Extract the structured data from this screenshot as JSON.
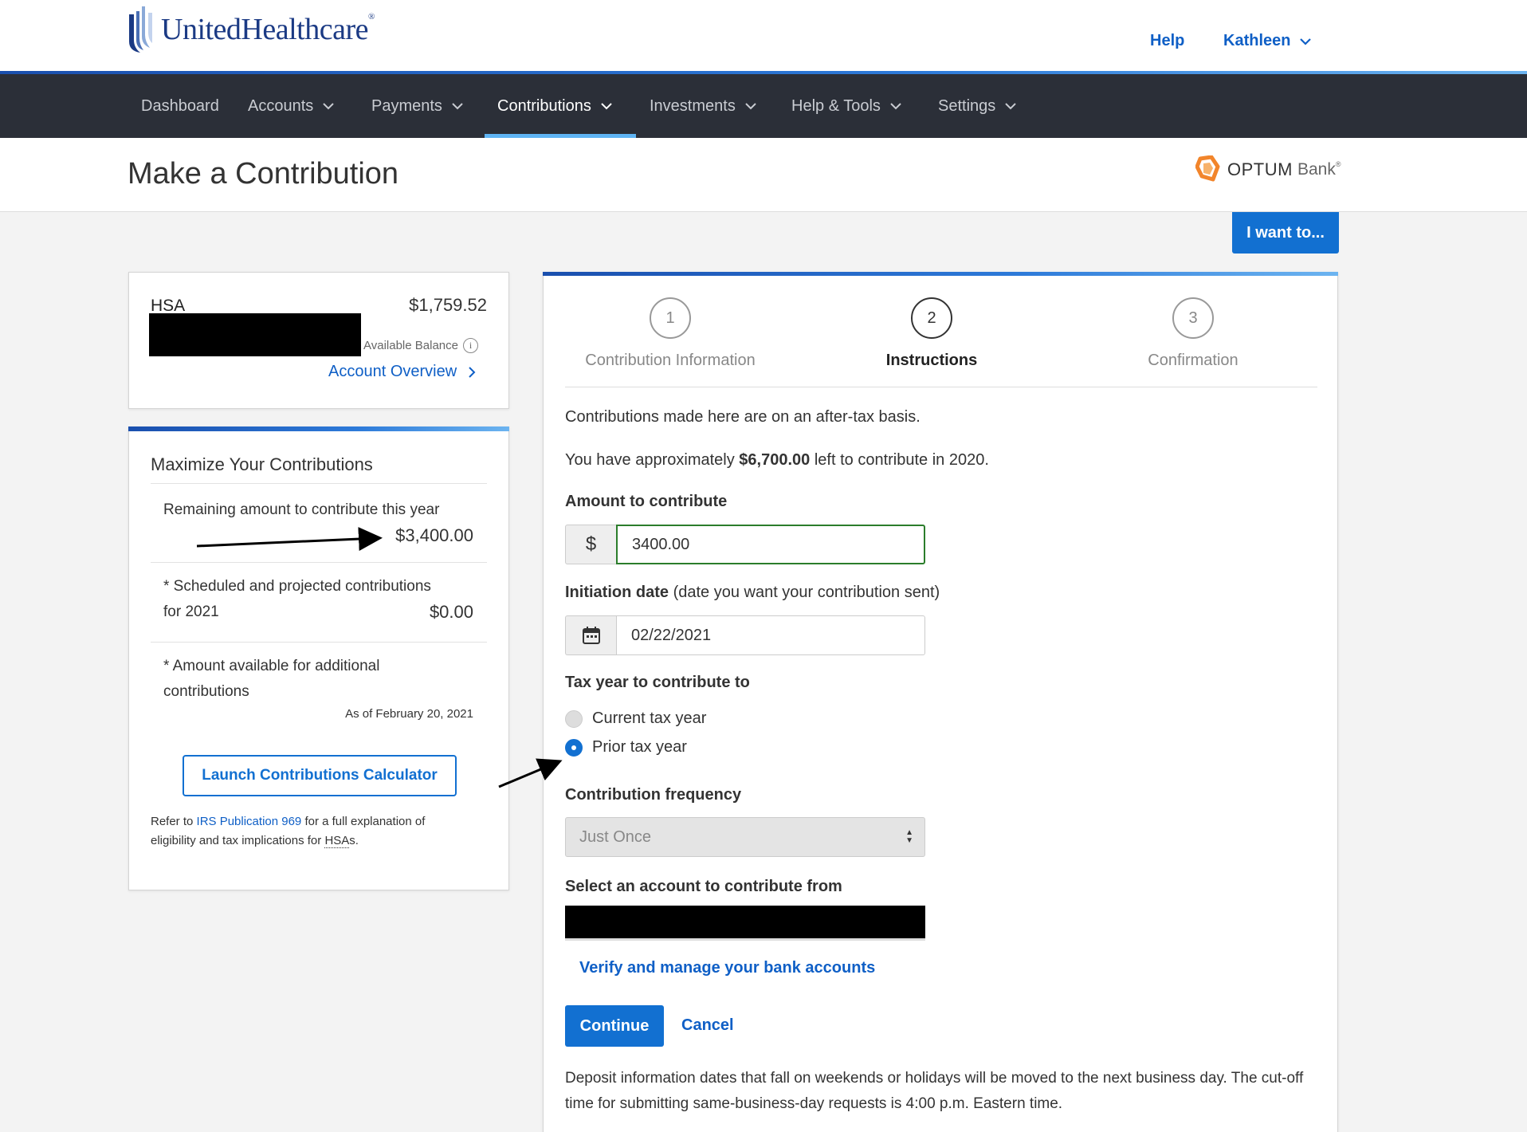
{
  "header": {
    "brand": "UnitedHealthcare",
    "brand_reg": "®",
    "help": "Help",
    "user": "Kathleen"
  },
  "nav": {
    "items": [
      {
        "label": "Dashboard"
      },
      {
        "label": "Accounts"
      },
      {
        "label": "Payments"
      },
      {
        "label": "Contributions"
      },
      {
        "label": "Investments"
      },
      {
        "label": "Help & Tools"
      },
      {
        "label": "Settings"
      }
    ],
    "active": "Contributions"
  },
  "page": {
    "title": "Make a Contribution",
    "bank_name": "OPTUM",
    "bank_suffix": "Bank",
    "bank_reg": "®",
    "i_want_to": "I want to..."
  },
  "account": {
    "name": "HSA",
    "balance": "$1,759.52",
    "balance_label": "Available Balance",
    "overview_link": "Account Overview"
  },
  "maximize": {
    "title": "Maximize Your Contributions",
    "remaining_label": "Remaining amount to contribute this year",
    "remaining_value": "$3,400.00",
    "scheduled_label_1": "* Scheduled and projected contributions",
    "scheduled_label_2": "for 2021",
    "scheduled_value": "$0.00",
    "available_label_1": "* Amount available for additional",
    "available_label_2": "contributions",
    "as_of": "As of February 20, 2021",
    "calc_button": "Launch Contributions Calculator",
    "refer_prefix": "Refer to",
    "refer_link": "IRS Publication 969",
    "refer_suffix_1": "for a full explanation of",
    "refer_suffix_2": "eligibility and tax implications for",
    "refer_abbr": "HSA",
    "refer_end": "s."
  },
  "steps": [
    {
      "number": "1",
      "label": "Contribution Information"
    },
    {
      "number": "2",
      "label": "Instructions"
    },
    {
      "number": "3",
      "label": "Confirmation"
    }
  ],
  "form": {
    "after_tax_note": "Contributions made here are on an after-tax basis.",
    "approx_prefix": "You have approximately",
    "approx_amount": "$6,700.00",
    "approx_suffix": "left to contribute in 2020.",
    "amount_label": "Amount to contribute",
    "currency_symbol": "$",
    "amount_value": "3400.00",
    "date_label": "Initiation date",
    "date_hint": "(date you want your contribution sent)",
    "date_value": "02/22/2021",
    "tax_year_label": "Tax year to contribute to",
    "tax_year_options": [
      "Current tax year",
      "Prior tax year"
    ],
    "tax_year_selected": "Prior tax year",
    "frequency_label": "Contribution frequency",
    "frequency_value": "Just Once",
    "source_label": "Select an account to contribute from",
    "verify_link": "Verify and manage your bank accounts",
    "continue": "Continue",
    "cancel": "Cancel",
    "footnote": "Deposit information dates that fall on weekends or holidays will be moved to the next business day. The cut-off time for submitting same-business-day requests is 4:00 p.m. Eastern time."
  },
  "colors": {
    "brand_blue": "#1b3a84",
    "link_blue": "#0f5fc6",
    "button_blue": "#1270d1",
    "nav_bg": "#2b2f38",
    "valid_green": "#2b7d2b",
    "optum_orange": "#f2852b"
  }
}
